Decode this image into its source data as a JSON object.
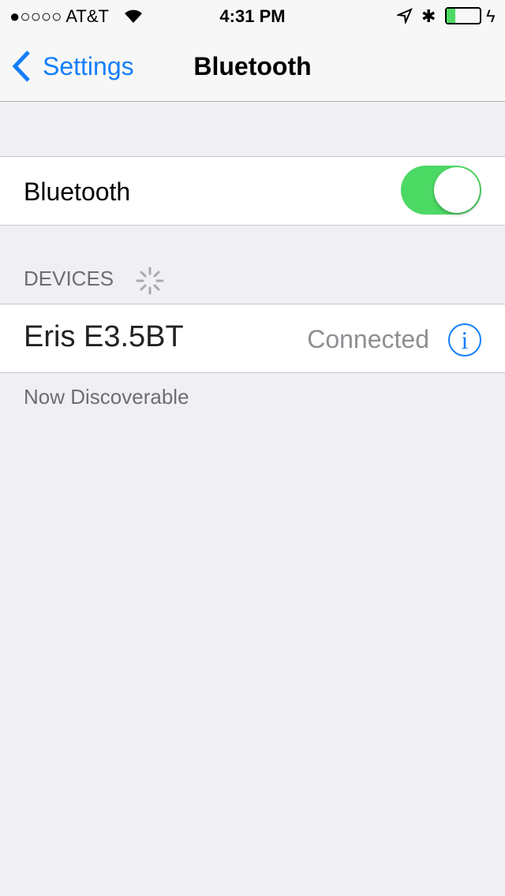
{
  "status": {
    "signal": "●○○○○",
    "carrier": "AT&T",
    "time": "4:31 PM",
    "battery_percent": 25,
    "charging": true
  },
  "nav": {
    "back_label": "Settings",
    "title": "Bluetooth"
  },
  "bluetooth": {
    "label": "Bluetooth",
    "enabled": true,
    "accent": "#4cd964"
  },
  "devices": {
    "header": "DEVICES",
    "items": [
      {
        "name": "Eris E3.5BT",
        "status": "Connected"
      }
    ]
  },
  "footer": "Now Discoverable"
}
